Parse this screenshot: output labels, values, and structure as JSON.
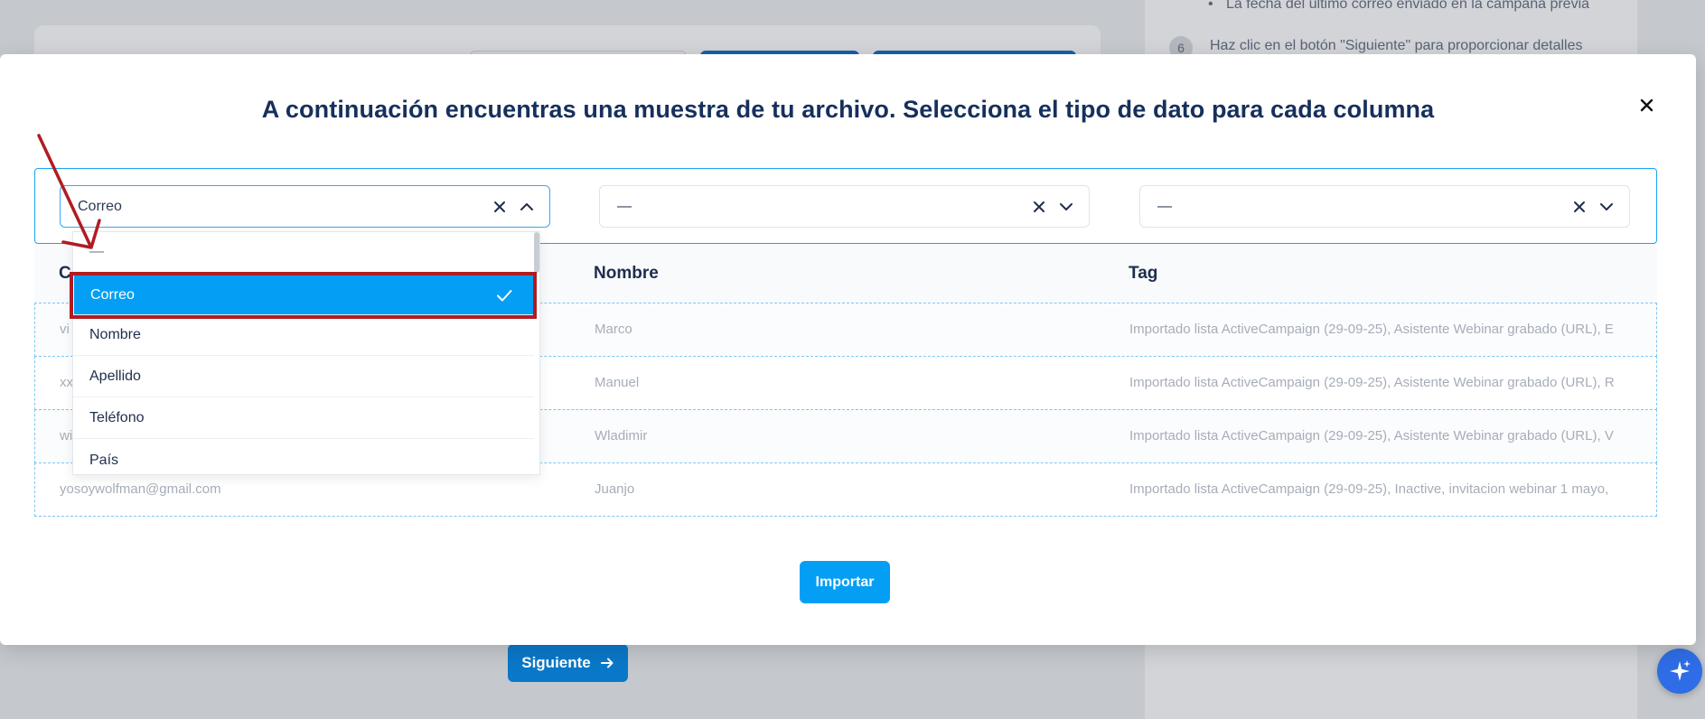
{
  "background": {
    "side_bullet_text": "La fecha del último correo enviado en la campaña previa",
    "step_number": "6",
    "step_text": "Haz clic en el botón \"Siguiente\" para proporcionar detalles",
    "next_button_label": "Siguiente"
  },
  "modal": {
    "title": "A continuación encuentras una muestra de tu archivo. Selecciona el tipo de dato para cada columna",
    "selects": [
      {
        "value": "Correo"
      },
      {
        "value": "—"
      },
      {
        "value": "—"
      }
    ],
    "columns": [
      "C",
      "Nombre",
      "Tag"
    ],
    "rows": [
      [
        "vi",
        "Marco",
        "Importado lista ActiveCampaign (29-09-25), Asistente Webinar grabado (URL), E"
      ],
      [
        "xx",
        "Manuel",
        "Importado lista ActiveCampaign (29-09-25), Asistente Webinar grabado (URL), R"
      ],
      [
        "wi",
        "Wladimir",
        "Importado lista ActiveCampaign (29-09-25), Asistente Webinar grabado (URL), V"
      ],
      [
        "yosoywolfman@gmail.com",
        "Juanjo",
        "Importado lista ActiveCampaign (29-09-25), Inactive, invitacion webinar 1 mayo,"
      ]
    ],
    "import_label": "Importar"
  },
  "dropdown": {
    "placeholder": "—",
    "options": [
      "Correo",
      "Nombre",
      "Apellido",
      "Teléfono",
      "País"
    ],
    "selected": "Correo"
  },
  "colors": {
    "accent": "#049ff5",
    "title": "#16305c",
    "annotation": "#b01c22"
  }
}
